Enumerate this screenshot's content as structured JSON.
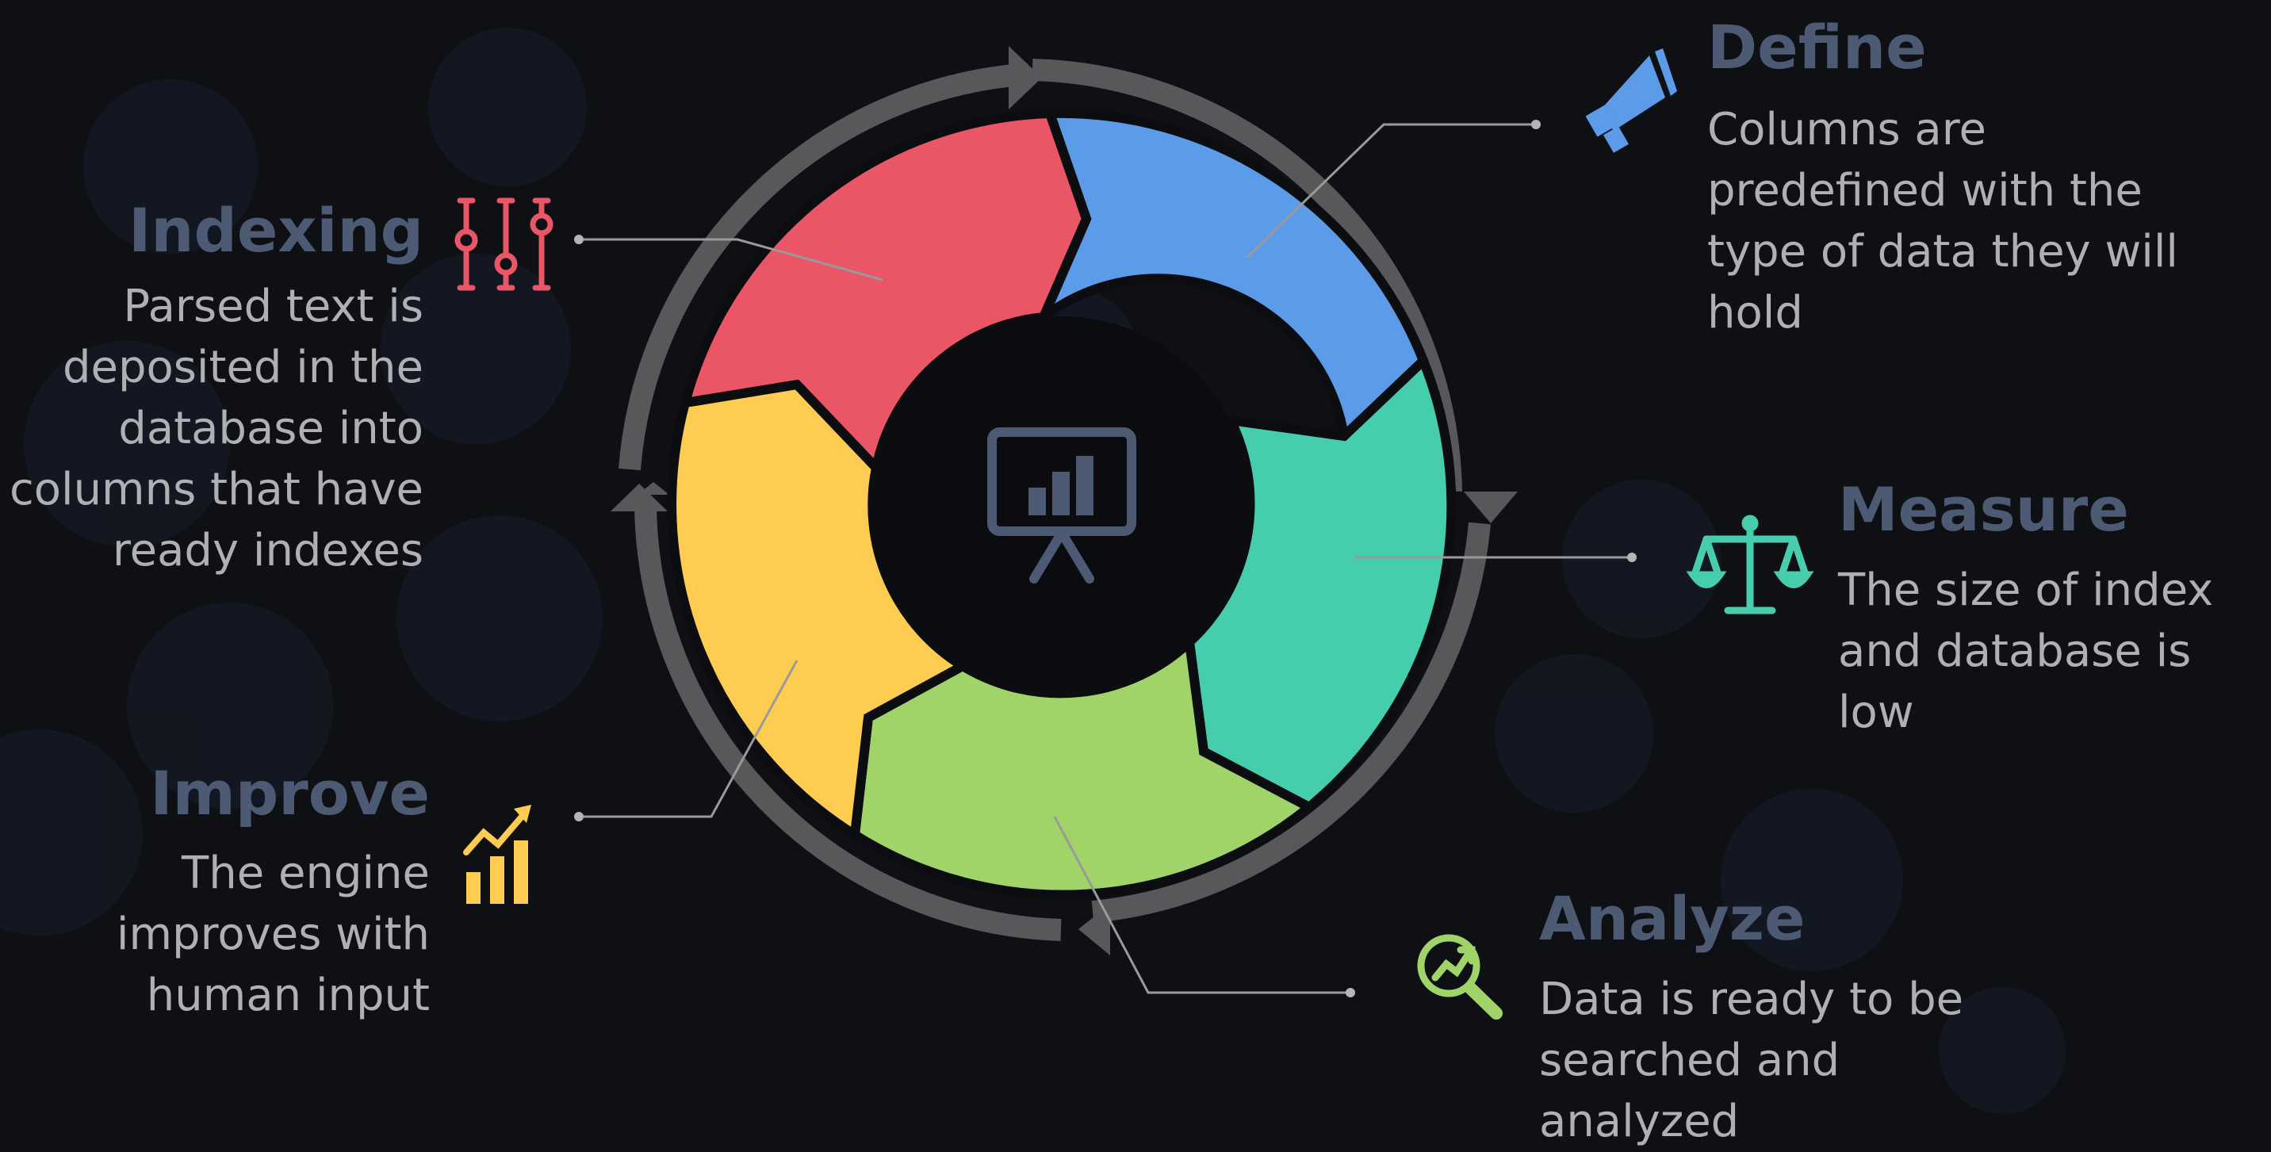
{
  "center": {
    "icon": "presentation-chart-icon"
  },
  "stages": [
    {
      "key": "define",
      "title": "Define",
      "description": "Columns are predefined with the type of data they will hold",
      "color": "#5b9be8",
      "icon": "megaphone-icon"
    },
    {
      "key": "measure",
      "title": "Measure",
      "description": "The size of index and database is low",
      "color": "#46cdad",
      "icon": "scale-icon"
    },
    {
      "key": "analyze",
      "title": "Analyze",
      "description": "Data is ready to be searched and analyzed",
      "color": "#a0d469",
      "icon": "magnifier-chart-icon"
    },
    {
      "key": "improve",
      "title": "Improve",
      "description": "The engine improves with human input",
      "color": "#fdcc51",
      "icon": "growth-chart-icon"
    },
    {
      "key": "indexing",
      "title": "Indexing",
      "description": "Parsed text is deposited in the database into columns that have ready indexes",
      "color": "#eb5666",
      "icon": "sliders-icon"
    }
  ],
  "colors": {
    "background": "#0f1014",
    "ring": "#575859",
    "title": "#4d5a73",
    "text": "#aeb0b3",
    "leader": "#9a9a9a",
    "hub": "#0b0c10"
  }
}
